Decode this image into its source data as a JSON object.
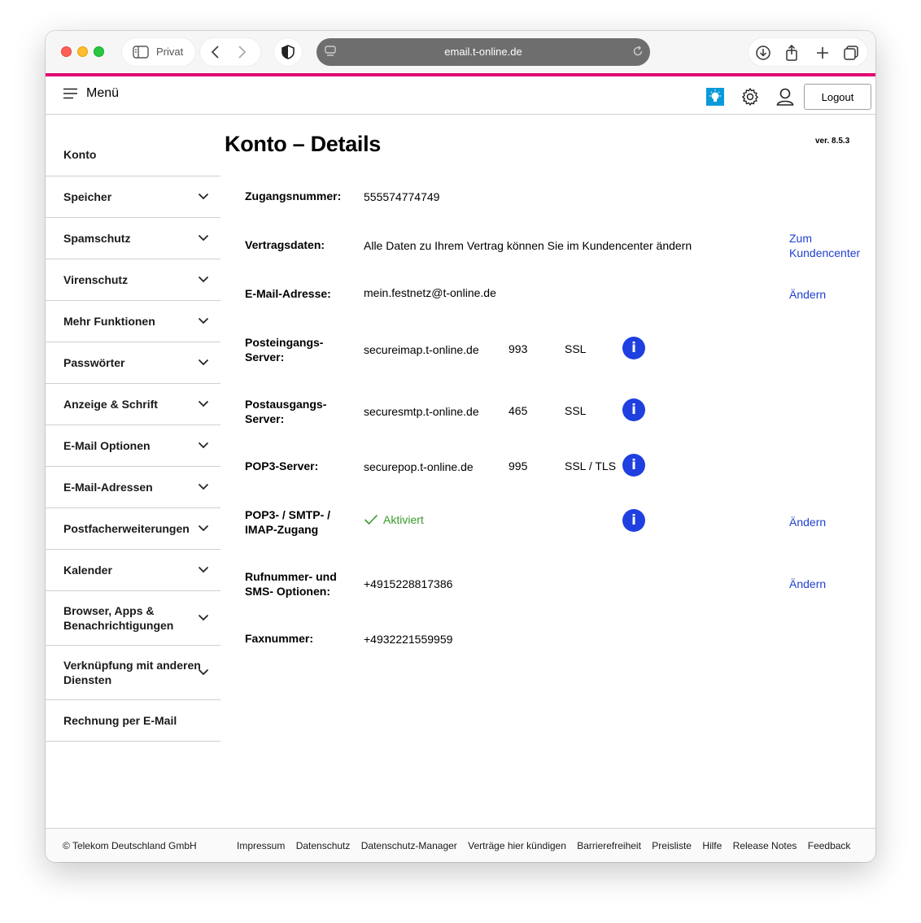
{
  "browser": {
    "tab_label": "Privat",
    "url": "email.t-online.de"
  },
  "header": {
    "menu_label": "Menü",
    "logout_label": "Logout"
  },
  "sidebar": {
    "items": [
      {
        "label": "Konto",
        "has_chevron": false
      },
      {
        "label": "Speicher",
        "has_chevron": true
      },
      {
        "label": "Spamschutz",
        "has_chevron": true
      },
      {
        "label": "Virenschutz",
        "has_chevron": true
      },
      {
        "label": "Mehr Funktionen",
        "has_chevron": true
      },
      {
        "label": "Passwörter",
        "has_chevron": true
      },
      {
        "label": "Anzeige & Schrift",
        "has_chevron": true
      },
      {
        "label": "E-Mail Optionen",
        "has_chevron": true
      },
      {
        "label": "E-Mail-Adressen",
        "has_chevron": true
      },
      {
        "label": "Postfacherweiterungen",
        "has_chevron": true
      },
      {
        "label": "Kalender",
        "has_chevron": true
      },
      {
        "label": "Browser, Apps & Benachrichtigungen",
        "has_chevron": true
      },
      {
        "label": "Verknüpfung mit anderen Diensten",
        "has_chevron": true
      },
      {
        "label": "Rechnung per E-Mail",
        "has_chevron": false
      }
    ]
  },
  "main": {
    "title": "Konto – Details",
    "version": "ver. 8.5.3",
    "zugangsnummer": {
      "label": "Zugangsnummer:",
      "value": "555574774749"
    },
    "vertragsdaten": {
      "label": "Vertragsdaten:",
      "value": "Alle Daten zu Ihrem Vertrag können Sie im Kundencenter ändern",
      "link": "Zum Kundencenter"
    },
    "email": {
      "label": "E-Mail-Adresse:",
      "value": "mein.festnetz@t-online.de",
      "link": "Ändern"
    },
    "posteingang": {
      "label": "Posteingangs-Server:",
      "host": "secureimap.t-online.de",
      "port": "993",
      "security": "SSL",
      "info": "i"
    },
    "postausgang": {
      "label": "Postausgangs-Server:",
      "host": "securesmtp.t-online.de",
      "port": "465",
      "security": "SSL",
      "info": "i"
    },
    "pop3": {
      "label": "POP3-Server:",
      "host": "securepop.t-online.de",
      "port": "995",
      "security": "SSL / TLS",
      "info": "i"
    },
    "zugang": {
      "label": "POP3- / SMTP- / IMAP-Zugang",
      "status": "Aktiviert",
      "info": "i",
      "link": "Ändern"
    },
    "rufnummer": {
      "label": "Rufnummer- und SMS- Optionen:",
      "value": "+4915228817386",
      "link": "Ändern"
    },
    "fax": {
      "label": "Faxnummer:",
      "value": "+4932221559959"
    }
  },
  "footer": {
    "copyright": "© Telekom Deutschland GmbH",
    "links": [
      "Impressum",
      "Datenschutz",
      "Datenschutz-Manager",
      "Verträge hier kündigen",
      "Barrierefreiheit",
      "Preisliste",
      "Hilfe",
      "Release Notes",
      "Feedback"
    ]
  },
  "colors": {
    "brand_magenta": "#e20074",
    "link_blue": "#1f3fcf",
    "info_blue": "#1f3fe0",
    "success_green": "#3a9a2c"
  }
}
